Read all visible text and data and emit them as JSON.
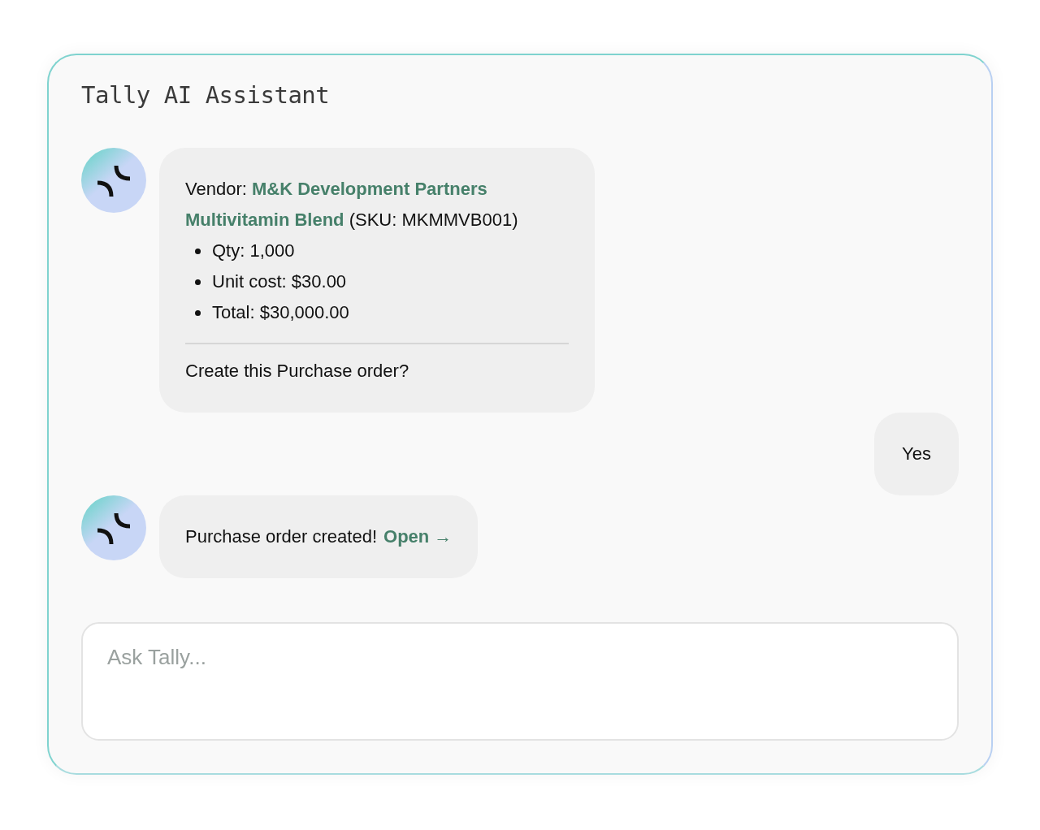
{
  "title": "Tally AI Assistant",
  "messages": [
    {
      "kind": "assistant",
      "intro": "Vendor: **M&K Development Partners Multivitamin Blend** (SKU: MKMMVB001)",
      "bullets": [
        "Qty: 1,000",
        "Unit cost: $30.00",
        "Total: $30,000.00"
      ],
      "question": "Create this Purchase order?"
    },
    {
      "kind": "user",
      "text": "Yes"
    },
    {
      "kind": "assistant",
      "text": "Purchase order created!",
      "link": "Open →"
    }
  ],
  "input": {
    "placeholder": "Ask Tally..."
  }
}
